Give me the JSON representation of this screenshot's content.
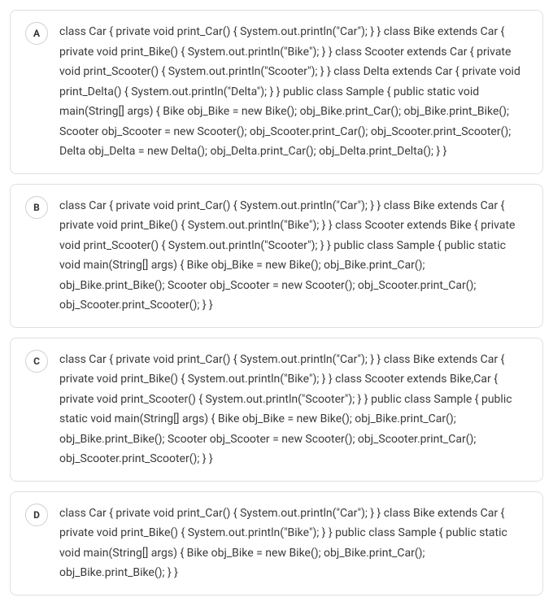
{
  "options": [
    {
      "letter": "A",
      "code": "class Car { private void print_Car() { System.out.println(\"Car\"); } } class Bike extends Car { private void print_Bike() { System.out.println(\"Bike\"); } } class Scooter extends Car { private void print_Scooter() { System.out.println(\"Scooter\"); } } class Delta extends Car { private void print_Delta() { System.out.println(\"Delta\"); } } public class Sample { public static void main(String[] args) { Bike obj_Bike = new Bike(); obj_Bike.print_Car(); obj_Bike.print_Bike(); Scooter obj_Scooter = new Scooter(); obj_Scooter.print_Car(); obj_Scooter.print_Scooter(); Delta obj_Delta = new Delta(); obj_Delta.print_Car(); obj_Delta.print_Delta(); } }"
    },
    {
      "letter": "B",
      "code": "class Car { private void print_Car() { System.out.println(\"Car\"); } } class Bike extends Car { private void print_Bike() { System.out.println(\"Bike\"); } } class Scooter extends Bike { private void print_Scooter() { System.out.println(\"Scooter\"); } } public class Sample { public static void main(String[] args) { Bike obj_Bike = new Bike(); obj_Bike.print_Car(); obj_Bike.print_Bike(); Scooter obj_Scooter = new Scooter(); obj_Scooter.print_Car(); obj_Scooter.print_Scooter(); } }"
    },
    {
      "letter": "C",
      "code": "class Car { private void print_Car() { System.out.println(\"Car\"); } } class Bike extends Car { private void print_Bike() { System.out.println(\"Bike\"); } } class Scooter extends Bike,Car { private void print_Scooter() { System.out.println(\"Scooter\"); } } public class Sample { public static void main(String[] args) { Bike obj_Bike = new Bike(); obj_Bike.print_Car(); obj_Bike.print_Bike(); Scooter obj_Scooter = new Scooter(); obj_Scooter.print_Car(); obj_Scooter.print_Scooter(); } }"
    },
    {
      "letter": "D",
      "code": "class Car { private void print_Car() { System.out.println(\"Car\"); } } class Bike extends Car { private void print_Bike() { System.out.println(\"Bike\"); } } public class Sample { public static void main(String[] args) { Bike obj_Bike = new Bike(); obj_Bike.print_Car(); obj_Bike.print_Bike(); } }"
    }
  ]
}
